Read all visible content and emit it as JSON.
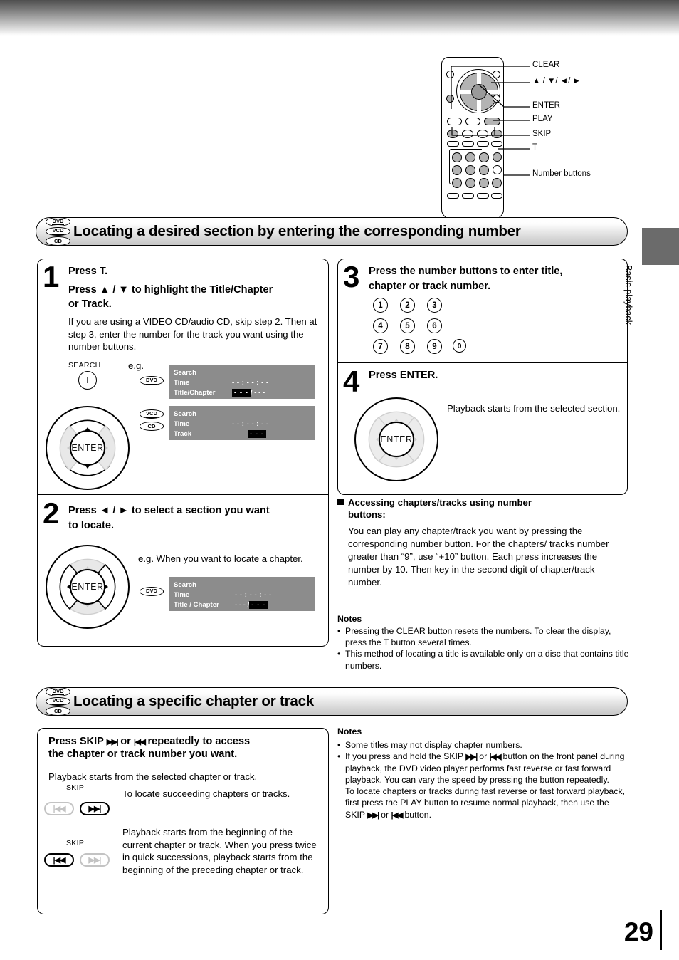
{
  "page": {
    "number": "29",
    "side_tab_label": "Basic playback"
  },
  "remote": {
    "callouts": [
      {
        "label": "CLEAR"
      },
      {
        "label": "▲ / ▼/ ◄/ ►"
      },
      {
        "label": "ENTER"
      },
      {
        "label": "PLAY"
      },
      {
        "label": "SKIP"
      },
      {
        "label": "T"
      },
      {
        "label": "Number buttons"
      }
    ]
  },
  "section1": {
    "title": "Locating a desired section by entering the corresponding number",
    "badges": [
      "DVD",
      "VCD",
      "CD"
    ],
    "step1": {
      "number": "1",
      "title_line1": "Press T.",
      "title_line2": "Press ▲ / ▼ to highlight the Title/Chapter",
      "title_line3": "or Track.",
      "body": "If you are using a VIDEO CD/audio CD, skip step 2. Then at step 3, enter the number for the track you want using the number buttons.",
      "search_label": "SEARCH",
      "t_button": "T",
      "eg_label": "e.g.",
      "osd_dvd": {
        "badge": "DVD",
        "title": "Search",
        "row_time_label": "Time",
        "row_time_value": "- - : - - : - -",
        "row_tc_label": "Title/Chapter",
        "row_tc_highlight": "- - -",
        "row_tc_rest": "/ - - -"
      },
      "osd_vcd": {
        "badge1": "VCD",
        "badge2": "CD",
        "title": "Search",
        "row_time_label": "Time",
        "row_time_value": "- - : - - : - -",
        "row_track_label": "Track",
        "row_track_highlight": "- - -"
      },
      "enter_label": "ENTER"
    },
    "step2": {
      "number": "2",
      "title_line1": "Press ◄ / ► to select a section you want",
      "title_line2": "to locate.",
      "caption": "e.g. When you want to locate a chapter.",
      "enter_label": "ENTER",
      "osd": {
        "badge": "DVD",
        "title": "Search",
        "row_time_label": "Time",
        "row_time_value": "- - : - - : - -",
        "row_tc_label": "Title / Chapter",
        "row_tc_pre": "- - - /",
        "row_tc_highlight": "- - -"
      }
    },
    "step3": {
      "number": "3",
      "title_line1": "Press the number buttons to enter title,",
      "title_line2": "chapter or track number.",
      "keys": [
        "1",
        "2",
        "3",
        "4",
        "5",
        "6",
        "7",
        "8",
        "9",
        "0"
      ]
    },
    "step4": {
      "number": "4",
      "title": "Press ENTER.",
      "body": "Playback starts from the selected section.",
      "enter_label": "ENTER"
    },
    "accessing": {
      "heading_line1": "Accessing chapters/tracks using number",
      "heading_line2": "buttons:",
      "body": "You can play any chapter/track you want by pressing the corresponding number button. For the chapters/ tracks number greater than “9”, use “+10” button. Each press increases the number by 10. Then key in the second digit of chapter/track number."
    },
    "notes": {
      "heading": "Notes",
      "items": [
        "Pressing the CLEAR button resets the numbers. To clear the display, press the T button several times.",
        "This method of locating a title is available only on a disc that contains title numbers."
      ]
    }
  },
  "section2": {
    "title": "Locating a specific chapter or track",
    "badges": [
      "DVD",
      "VCD",
      "CD"
    ],
    "instruction": {
      "line1_a": "Press SKIP",
      "line1_b": "or",
      "line1_c": "repeatedly to access",
      "line2": "the chapter or track number you want.",
      "body": "Playback starts from the selected chapter or track."
    },
    "rows": [
      {
        "skip_label": "SKIP",
        "active": "forward",
        "text": "To locate succeeding chapters or tracks."
      },
      {
        "skip_label": "SKIP",
        "active": "reverse",
        "text": "Playback starts from the beginning of the current chapter or track. When you press twice in quick successions, playback starts from the beginning of the preceding chapter or track."
      }
    ],
    "notes": {
      "heading": "Notes",
      "item1": "Some titles may not display chapter numbers.",
      "item2_a": "If you press and hold the SKIP",
      "item2_b": "or",
      "item2_c": "button on the front panel during playback, the DVD video player performs fast reverse or fast forward playback.  You can vary the speed by pressing the button repeatedly.",
      "item2_d": "To locate chapters or tracks during fast reverse or fast forward playback, first press the PLAY button to resume normal playback, then use the SKIP",
      "item2_e": "or",
      "item2_f": "button."
    }
  },
  "colors": {
    "osd_bg": "#8c8c8c",
    "tab_gray": "#6b6b6b",
    "button_gray": "#b3b3b3"
  }
}
